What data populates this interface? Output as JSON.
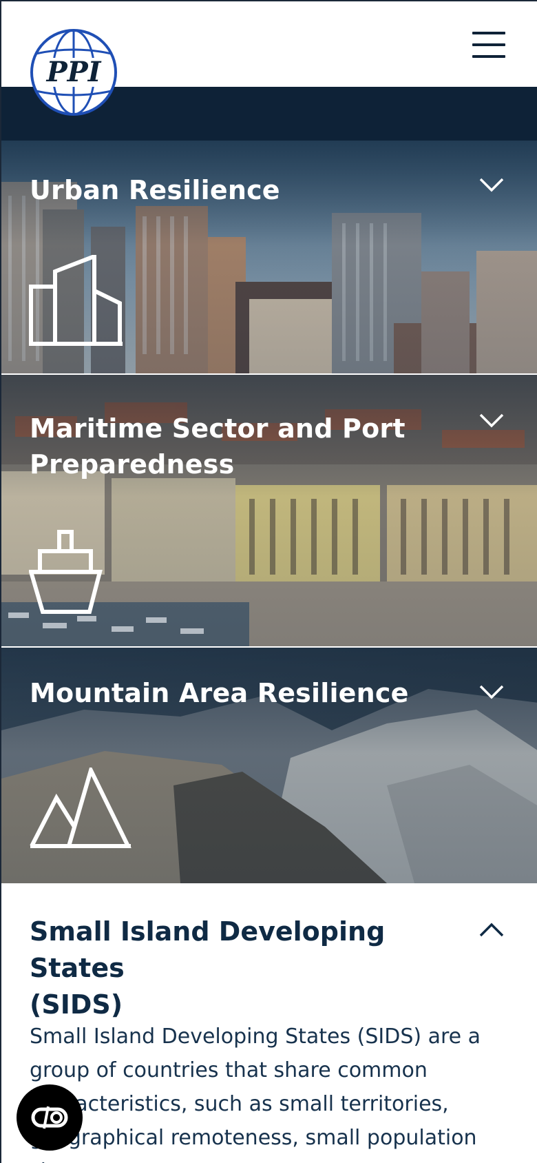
{
  "header": {
    "logo_text": "PPI",
    "logo_icon": "globe-logo",
    "menu_icon": "hamburger-menu-icon"
  },
  "panels": [
    {
      "title": "Urban Resilience",
      "icon": "buildings-icon",
      "chevron": "chevron-down-icon",
      "background": "city-skyline-photo"
    },
    {
      "title": "Maritime Sector and Port Preparedness",
      "title_line1": "Maritime Sector and Port",
      "title_line2": "Preparedness",
      "icon": "ship-icon",
      "chevron": "chevron-down-icon",
      "background": "harbour-town-photo"
    },
    {
      "title": "Mountain Area Resilience",
      "icon": "mountains-icon",
      "chevron": "chevron-down-icon",
      "background": "mountain-ridge-photo"
    }
  ],
  "open_section": {
    "title": "Small Island Developing States (SIDS)",
    "title_line1": "Small Island Developing States",
    "title_line2": "(SIDS)",
    "chevron": "chevron-up-icon",
    "body_line1": "Small Island Developing States (SIDS) are a",
    "body_line2": "group of countries that share common",
    "body_line3": "characteristics, such as small territories,",
    "body_line4": "geographical remoteness, small population size,"
  },
  "accessibility_button": {
    "icon": "accessibility-toggle-icon"
  },
  "colors": {
    "navy": "#0e2237",
    "title_text": "#0f2a44",
    "logo_blue": "#1f4fb5",
    "white": "#ffffff"
  }
}
